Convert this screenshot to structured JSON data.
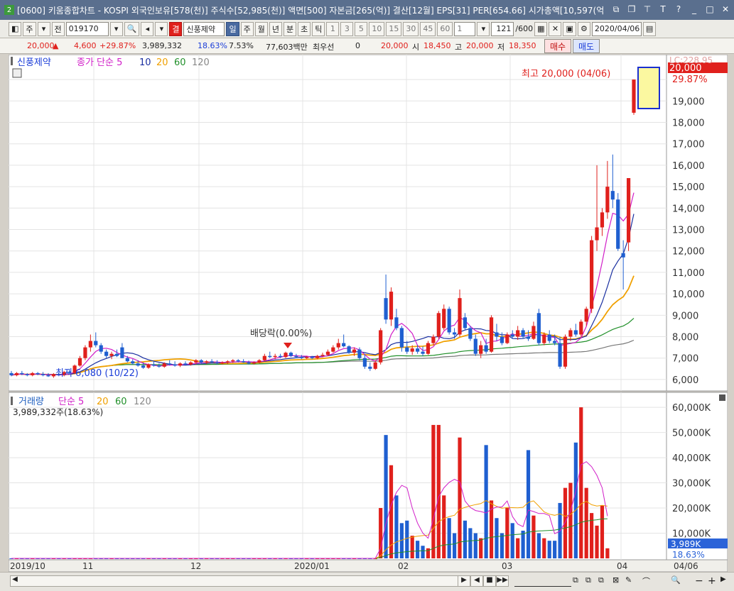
{
  "window": {
    "badge": "2",
    "title": "[0600] 키움종합차트 - KOSPI 외국인보유[578(천)] 주식수[52,985(천)] 액면[500] 자본금[265(억)] 결산[12월] EPS[31] PER[654.66] 시가총액[10,597(억"
  },
  "toolbar": {
    "period_sel": "주",
    "prev_label": "전",
    "code": "019170",
    "gyeol_label": "결",
    "stock_name": "신풍제약",
    "period_buttons": [
      "일",
      "주",
      "월",
      "년",
      "분",
      "초",
      "틱"
    ],
    "interval_buttons": [
      "1",
      "3",
      "5",
      "10",
      "15",
      "30",
      "45",
      "60"
    ],
    "interval_value": "1",
    "count": "121",
    "count_total": "/600",
    "date": "2020/04/06"
  },
  "quote": {
    "price": "20,000",
    "change": "4,600",
    "change_pct": "+29.87%",
    "volume": "3,989,332",
    "turnover_pct": "18.63%",
    "vol_ratio": "7.53%",
    "amount": "77,603백만",
    "best_label": "최우선",
    "best_value": "0",
    "best_price": "20,000",
    "open_label": "시",
    "open": "18,450",
    "high_label": "고",
    "high": "20,000",
    "low_label": "저",
    "low": "18,350",
    "buy_label": "매수",
    "sell_label": "매도"
  },
  "price_legend": {
    "name": "신풍제약",
    "ma_label": "종가 단순 5",
    "ma_10": "10",
    "ma_20": "20",
    "ma_60": "60",
    "ma_120": "120"
  },
  "annotations": {
    "high": "최고 20,000 (04/06)",
    "low": "최저 6,080 (10/22)",
    "dividend": "배당락(0.00%)"
  },
  "price_axis": {
    "ticks": [
      "20,000",
      "19,000",
      "18,000",
      "17,000",
      "16,000",
      "15,000",
      "14,000",
      "13,000",
      "12,000",
      "11,000",
      "10,000",
      "9,000",
      "8,000",
      "7,000",
      "6,000"
    ],
    "current": "20,000",
    "pct": "29.87%",
    "top_label": "LC:228.95"
  },
  "volume_legend": {
    "name": "거래량",
    "ma_label": "단순 5",
    "ma_20": "20",
    "ma_60": "60",
    "ma_120": "120",
    "current": "3,989,332주(18.63%)"
  },
  "volume_axis": {
    "ticks": [
      "60,000K",
      "50,000K",
      "40,000K",
      "30,000K",
      "20,000K",
      "10,000K"
    ],
    "current": "3,989K",
    "pct": "18.63%"
  },
  "time_axis": {
    "labels": [
      "2019/10",
      "11",
      "12",
      "2020/01",
      "02",
      "03",
      "04"
    ],
    "end_date": "04/06"
  },
  "colors": {
    "up": "#e0201c",
    "down": "#1f5fd0",
    "ma5": "#d11ec8",
    "ma10": "#1a2fa0",
    "ma20": "#f0a000",
    "ma60": "#21902a",
    "ma120": "#777777"
  },
  "chart_data": {
    "type": "candlestick",
    "price_range": [
      5600,
      20500
    ],
    "volume_range": [
      0,
      62000
    ],
    "volume_unit": "K shares",
    "candles": [
      {
        "o": 6300,
        "h": 6400,
        "l": 6150,
        "c": 6200
      },
      {
        "o": 6200,
        "h": 6350,
        "l": 6150,
        "c": 6300
      },
      {
        "o": 6300,
        "h": 6400,
        "l": 6200,
        "c": 6250
      },
      {
        "o": 6250,
        "h": 6300,
        "l": 6150,
        "c": 6200
      },
      {
        "o": 6200,
        "h": 6350,
        "l": 6150,
        "c": 6300
      },
      {
        "o": 6300,
        "h": 6350,
        "l": 6200,
        "c": 6250
      },
      {
        "o": 6250,
        "h": 6350,
        "l": 6150,
        "c": 6200
      },
      {
        "o": 6200,
        "h": 6300,
        "l": 6120,
        "c": 6150
      },
      {
        "o": 6150,
        "h": 6300,
        "l": 6080,
        "c": 6250
      },
      {
        "o": 6250,
        "h": 6350,
        "l": 6150,
        "c": 6200
      },
      {
        "o": 6200,
        "h": 6400,
        "l": 6150,
        "c": 6350
      },
      {
        "o": 6350,
        "h": 6500,
        "l": 6250,
        "c": 6300
      },
      {
        "o": 6300,
        "h": 6700,
        "l": 6250,
        "c": 6650
      },
      {
        "o": 6650,
        "h": 7100,
        "l": 6600,
        "c": 7000
      },
      {
        "o": 7000,
        "h": 7600,
        "l": 6900,
        "c": 7500
      },
      {
        "o": 7500,
        "h": 8100,
        "l": 7300,
        "c": 7800
      },
      {
        "o": 7800,
        "h": 8200,
        "l": 7500,
        "c": 7600
      },
      {
        "o": 7600,
        "h": 7700,
        "l": 7200,
        "c": 7300
      },
      {
        "o": 7300,
        "h": 7400,
        "l": 7000,
        "c": 7100
      },
      {
        "o": 7100,
        "h": 7300,
        "l": 6950,
        "c": 7200
      },
      {
        "o": 7200,
        "h": 7400,
        "l": 7050,
        "c": 7100
      },
      {
        "o": 7500,
        "h": 7700,
        "l": 7000,
        "c": 7000
      },
      {
        "o": 7000,
        "h": 7100,
        "l": 6800,
        "c": 6850
      },
      {
        "o": 6850,
        "h": 6950,
        "l": 6700,
        "c": 6750
      },
      {
        "o": 6750,
        "h": 6900,
        "l": 6600,
        "c": 6650
      },
      {
        "o": 6650,
        "h": 6800,
        "l": 6500,
        "c": 6550
      },
      {
        "o": 6550,
        "h": 6750,
        "l": 6500,
        "c": 6700
      },
      {
        "o": 6700,
        "h": 6850,
        "l": 6600,
        "c": 6650
      },
      {
        "o": 6650,
        "h": 6750,
        "l": 6550,
        "c": 6600
      },
      {
        "o": 6600,
        "h": 6800,
        "l": 6550,
        "c": 6750
      },
      {
        "o": 6750,
        "h": 6900,
        "l": 6650,
        "c": 6700
      },
      {
        "o": 6700,
        "h": 6850,
        "l": 6600,
        "c": 6650
      },
      {
        "o": 6650,
        "h": 6800,
        "l": 6580,
        "c": 6750
      },
      {
        "o": 6750,
        "h": 6850,
        "l": 6650,
        "c": 6700
      },
      {
        "o": 6700,
        "h": 6850,
        "l": 6650,
        "c": 6800
      },
      {
        "o": 6800,
        "h": 6950,
        "l": 6700,
        "c": 6900
      },
      {
        "o": 6900,
        "h": 6950,
        "l": 6750,
        "c": 6800
      },
      {
        "o": 6800,
        "h": 6900,
        "l": 6720,
        "c": 6850
      },
      {
        "o": 6850,
        "h": 6950,
        "l": 6750,
        "c": 6800
      },
      {
        "o": 6800,
        "h": 6900,
        "l": 6700,
        "c": 6750
      },
      {
        "o": 6750,
        "h": 6850,
        "l": 6700,
        "c": 6800
      },
      {
        "o": 6800,
        "h": 6900,
        "l": 6720,
        "c": 6850
      },
      {
        "o": 6850,
        "h": 6950,
        "l": 6780,
        "c": 6900
      },
      {
        "o": 6900,
        "h": 6950,
        "l": 6800,
        "c": 6850
      },
      {
        "o": 6850,
        "h": 6950,
        "l": 6780,
        "c": 6800
      },
      {
        "o": 6800,
        "h": 6880,
        "l": 6700,
        "c": 6750
      },
      {
        "o": 6750,
        "h": 6850,
        "l": 6700,
        "c": 6800
      },
      {
        "o": 6800,
        "h": 6950,
        "l": 6750,
        "c": 6900
      },
      {
        "o": 6900,
        "h": 7200,
        "l": 6850,
        "c": 7100
      },
      {
        "o": 7100,
        "h": 7300,
        "l": 7000,
        "c": 7050
      },
      {
        "o": 7050,
        "h": 7200,
        "l": 6950,
        "c": 7100
      },
      {
        "o": 7100,
        "h": 7200,
        "l": 7000,
        "c": 7050
      },
      {
        "o": 7050,
        "h": 7300,
        "l": 7000,
        "c": 7250
      },
      {
        "o": 7250,
        "h": 7300,
        "l": 7050,
        "c": 7100
      },
      {
        "o": 7100,
        "h": 7200,
        "l": 7000,
        "c": 7050
      },
      {
        "o": 7050,
        "h": 7150,
        "l": 6950,
        "c": 7000
      },
      {
        "o": 7000,
        "h": 7100,
        "l": 6950,
        "c": 7050
      },
      {
        "o": 7050,
        "h": 7100,
        "l": 6950,
        "c": 7000
      },
      {
        "o": 7000,
        "h": 7150,
        "l": 6950,
        "c": 7100
      },
      {
        "o": 7100,
        "h": 7250,
        "l": 7050,
        "c": 7150
      },
      {
        "o": 7150,
        "h": 7400,
        "l": 7100,
        "c": 7300
      },
      {
        "o": 7300,
        "h": 7600,
        "l": 7250,
        "c": 7500
      },
      {
        "o": 7500,
        "h": 7900,
        "l": 7400,
        "c": 7700
      },
      {
        "o": 7700,
        "h": 8100,
        "l": 7500,
        "c": 7550
      },
      {
        "o": 7550,
        "h": 7600,
        "l": 7200,
        "c": 7250
      },
      {
        "o": 7250,
        "h": 7500,
        "l": 7100,
        "c": 7400
      },
      {
        "o": 7400,
        "h": 7500,
        "l": 6900,
        "c": 7000
      },
      {
        "o": 7000,
        "h": 7200,
        "l": 6500,
        "c": 6600
      },
      {
        "o": 6600,
        "h": 6800,
        "l": 6400,
        "c": 6500
      },
      {
        "o": 6500,
        "h": 6900,
        "l": 6450,
        "c": 6800
      },
      {
        "o": 6800,
        "h": 8400,
        "l": 6700,
        "c": 8300
      },
      {
        "o": 9800,
        "h": 10900,
        "l": 8600,
        "c": 8800
      },
      {
        "o": 8800,
        "h": 10300,
        "l": 8500,
        "c": 10100
      },
      {
        "o": 8900,
        "h": 9300,
        "l": 8300,
        "c": 8400
      },
      {
        "o": 8400,
        "h": 8500,
        "l": 7300,
        "c": 7500
      },
      {
        "o": 7500,
        "h": 7800,
        "l": 7200,
        "c": 7300
      },
      {
        "o": 7300,
        "h": 7600,
        "l": 7150,
        "c": 7450
      },
      {
        "o": 7450,
        "h": 7600,
        "l": 7200,
        "c": 7300
      },
      {
        "o": 7300,
        "h": 7550,
        "l": 7100,
        "c": 7200
      },
      {
        "o": 7200,
        "h": 7800,
        "l": 7150,
        "c": 7700
      },
      {
        "o": 7700,
        "h": 8100,
        "l": 7600,
        "c": 8000
      },
      {
        "o": 8000,
        "h": 9200,
        "l": 7900,
        "c": 9100
      },
      {
        "o": 8400,
        "h": 9500,
        "l": 8300,
        "c": 9300
      },
      {
        "o": 9300,
        "h": 9400,
        "l": 8100,
        "c": 8200
      },
      {
        "o": 8200,
        "h": 8400,
        "l": 7900,
        "c": 8100
      },
      {
        "o": 8100,
        "h": 10200,
        "l": 8000,
        "c": 9800
      },
      {
        "o": 8900,
        "h": 9100,
        "l": 8300,
        "c": 8400
      },
      {
        "o": 8400,
        "h": 8500,
        "l": 7800,
        "c": 7900
      },
      {
        "o": 7900,
        "h": 8100,
        "l": 7100,
        "c": 7200
      },
      {
        "o": 7200,
        "h": 7800,
        "l": 7000,
        "c": 7600
      },
      {
        "o": 7600,
        "h": 7900,
        "l": 7200,
        "c": 7300
      },
      {
        "o": 7300,
        "h": 9000,
        "l": 7250,
        "c": 8900
      },
      {
        "o": 8200,
        "h": 8600,
        "l": 7800,
        "c": 8000
      },
      {
        "o": 8000,
        "h": 8200,
        "l": 7600,
        "c": 7700
      },
      {
        "o": 7700,
        "h": 8200,
        "l": 7650,
        "c": 8100
      },
      {
        "o": 8100,
        "h": 8300,
        "l": 7900,
        "c": 8000
      },
      {
        "o": 8000,
        "h": 8500,
        "l": 7850,
        "c": 8300
      },
      {
        "o": 8300,
        "h": 8400,
        "l": 7900,
        "c": 8000
      },
      {
        "o": 8000,
        "h": 8300,
        "l": 7800,
        "c": 7900
      },
      {
        "o": 7900,
        "h": 8700,
        "l": 7850,
        "c": 8500
      },
      {
        "o": 9100,
        "h": 9300,
        "l": 7600,
        "c": 7700
      },
      {
        "o": 7700,
        "h": 8200,
        "l": 7600,
        "c": 8100
      },
      {
        "o": 8100,
        "h": 8300,
        "l": 7700,
        "c": 7800
      },
      {
        "o": 7800,
        "h": 8100,
        "l": 7600,
        "c": 7700
      },
      {
        "o": 7700,
        "h": 8000,
        "l": 6500,
        "c": 6600
      },
      {
        "o": 6600,
        "h": 8100,
        "l": 6500,
        "c": 8000
      },
      {
        "o": 8000,
        "h": 8400,
        "l": 7800,
        "c": 8300
      },
      {
        "o": 8300,
        "h": 8600,
        "l": 8000,
        "c": 8100
      },
      {
        "o": 8100,
        "h": 8800,
        "l": 8000,
        "c": 8700
      },
      {
        "o": 8700,
        "h": 9400,
        "l": 8500,
        "c": 9300
      },
      {
        "o": 9300,
        "h": 12700,
        "l": 9100,
        "c": 12500
      },
      {
        "o": 12500,
        "h": 16000,
        "l": 12000,
        "c": 13100
      },
      {
        "o": 13100,
        "h": 14000,
        "l": 12700,
        "c": 13800
      },
      {
        "o": 13800,
        "h": 16200,
        "l": 13500,
        "c": 15000
      },
      {
        "o": 14800,
        "h": 16500,
        "l": 14000,
        "c": 14400
      },
      {
        "o": 14400,
        "h": 14700,
        "l": 12000,
        "c": 12100
      },
      {
        "o": 11900,
        "h": 12500,
        "l": 10200,
        "c": 11700
      },
      {
        "o": 12400,
        "h": 15400,
        "l": 12000,
        "c": 15400
      },
      {
        "o": 18450,
        "h": 20000,
        "l": 18350,
        "c": 20000
      }
    ],
    "volumes": [
      1,
      1,
      1,
      1,
      1,
      1,
      1,
      1,
      1,
      1,
      1,
      1,
      1,
      1,
      1,
      1,
      1,
      1,
      1,
      1,
      1,
      1,
      1,
      1,
      1,
      1,
      1,
      1,
      1,
      1,
      1,
      1,
      1,
      1,
      1,
      1,
      1,
      1,
      1,
      1,
      1,
      1,
      1,
      1,
      1,
      1,
      1,
      1,
      1,
      1,
      1,
      1,
      1,
      1,
      1,
      1,
      1,
      1,
      1,
      1,
      1,
      1,
      1,
      1,
      1,
      1,
      1,
      1,
      1,
      1,
      20000,
      49000,
      37000,
      25000,
      14000,
      15000,
      9000,
      7000,
      5000,
      4000,
      53000,
      53000,
      25000,
      16000,
      10000,
      48000,
      15000,
      12000,
      10000,
      8000,
      45000,
      23000,
      16000,
      10000,
      20000,
      14000,
      8000,
      11000,
      43000,
      17000,
      10000,
      8000,
      7000,
      7000,
      22000,
      28000,
      30000,
      46000,
      60000,
      28000,
      18000,
      13000,
      21000,
      4000
    ],
    "highest": "20,000 (04/06)",
    "lowest": "6,080 (10/22)"
  },
  "scroll": {
    "zoom_minus": "−",
    "zoom_plus": "+"
  }
}
